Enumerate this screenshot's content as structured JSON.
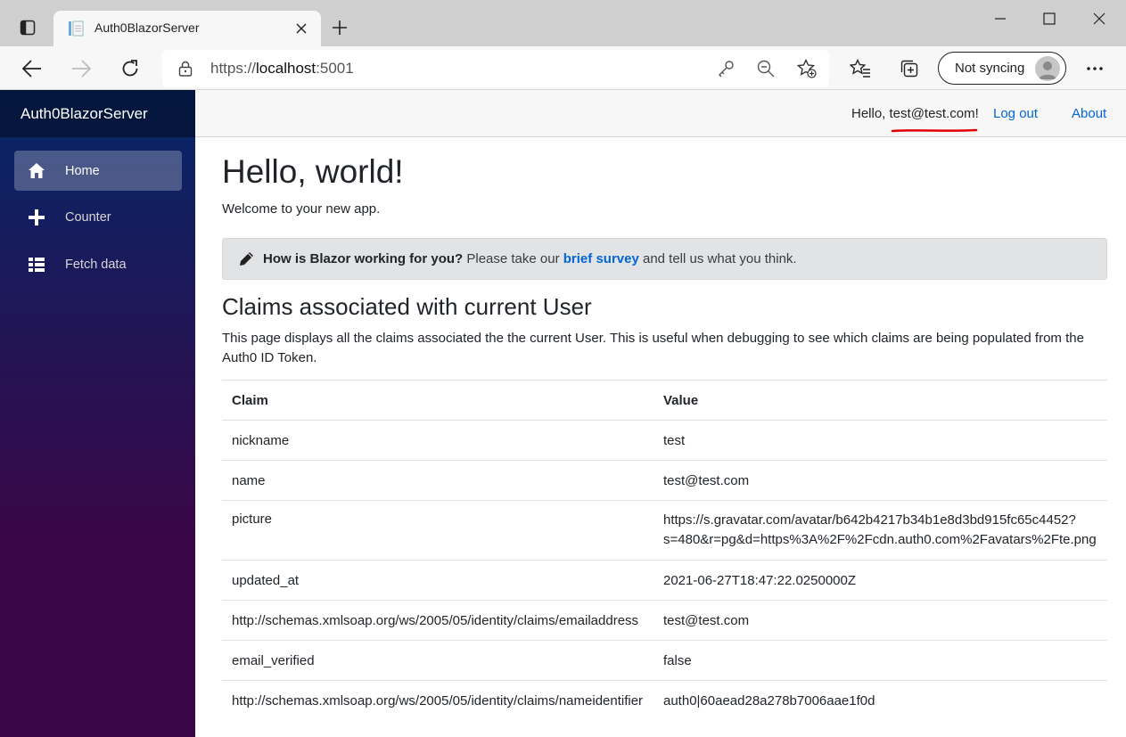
{
  "browser": {
    "tab_title": "Auth0BlazorServer",
    "url_prefix": "https://",
    "url_host": "localhost",
    "url_port": ":5001",
    "sync_label": "Not syncing"
  },
  "app": {
    "brand": "Auth0BlazorServer",
    "nav": [
      {
        "label": "Home",
        "icon": "home-icon",
        "active": true
      },
      {
        "label": "Counter",
        "icon": "plus-icon",
        "active": false
      },
      {
        "label": "Fetch data",
        "icon": "list-icon",
        "active": false
      }
    ],
    "topbar": {
      "hello": "Hello, test@test.com!",
      "logout": "Log out",
      "about": "About"
    }
  },
  "main": {
    "title": "Hello, world!",
    "welcome": "Welcome to your new app.",
    "survey": {
      "question": "How is Blazor working for you?",
      "pre_link": " Please take our ",
      "link": "brief survey",
      "post_link": " and tell us what you think."
    },
    "claims_title": "Claims associated with current User",
    "claims_desc": "This page displays all the claims associated the the current User. This is useful when debugging to see which claims are being populated from the Auth0 ID Token.",
    "table": {
      "headers": [
        "Claim",
        "Value"
      ],
      "rows": [
        {
          "claim": "nickname",
          "value": "test"
        },
        {
          "claim": "name",
          "value": "test@test.com"
        },
        {
          "claim": "picture",
          "value1": "https://s.gravatar.com/avatar/b642b4217b34b1e8d3bd915fc65c4452?",
          "value2": "s=480&r=pg&d=https%3A%2F%2Fcdn.auth0.com%2Favatars%2Fte.png"
        },
        {
          "claim": "updated_at",
          "value": "2021-06-27T18:47:22.0250000Z"
        },
        {
          "claim": "http://schemas.xmlsoap.org/ws/2005/05/identity/claims/emailaddress",
          "value": "test@test.com"
        },
        {
          "claim": "email_verified",
          "value": "false"
        },
        {
          "claim": "http://schemas.xmlsoap.org/ws/2005/05/identity/claims/nameidentifier",
          "value": "auth0|60aead28a278b7006aae1f0d"
        }
      ]
    }
  },
  "colors": {
    "link": "#0366d6",
    "sidebar_top": "#052767",
    "sidebar_bottom": "#3a0647",
    "annotation": "#e00000"
  }
}
